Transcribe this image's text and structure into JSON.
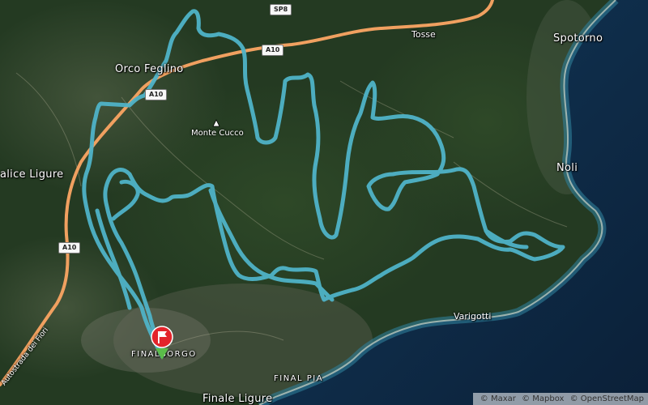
{
  "map": {
    "places": {
      "orco_feglino": "Orco Feglino",
      "spotorno": "Spotorno",
      "noli": "Noli",
      "calice_ligure": "alice Ligure",
      "varigotti": "Varigotti",
      "finalborgo": "FINALBORGO",
      "final_pia": "FINAL PIA",
      "finale_ligure": "Finale Ligure",
      "tosse": "Tosse"
    },
    "peak": {
      "name": "Monte Cucco",
      "icon": "mountain-peak-icon"
    },
    "roads": {
      "sp8": "SP8",
      "a10_top": "A10",
      "a10_mid": "A10",
      "a10_left": "A10",
      "autostrada": "Autostrada dei Fiori"
    },
    "route": {
      "color": "#4fb3c8",
      "marker_icon": "start-flag-marker-icon"
    },
    "colors": {
      "highway": "#f0a060",
      "sea": "#0f2a45",
      "forest": "#233a20"
    },
    "attribution": [
      "© Maxar",
      "© Mapbox",
      "© OpenStreetMap"
    ]
  }
}
